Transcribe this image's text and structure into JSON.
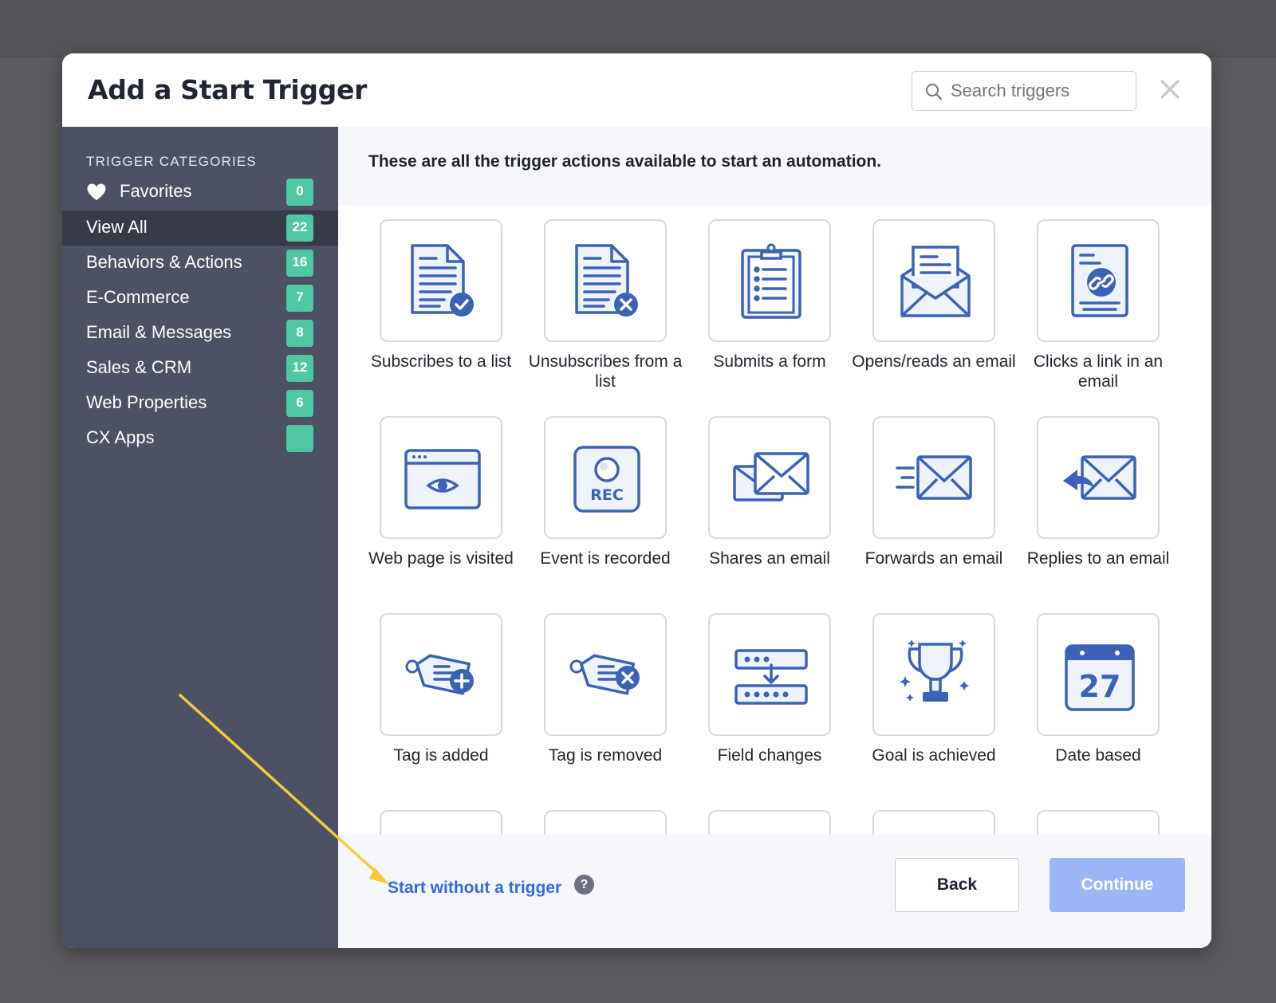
{
  "modal": {
    "title": "Add a Start Trigger",
    "search_placeholder": "Search triggers"
  },
  "sidebar": {
    "heading": "TRIGGER CATEGORIES",
    "categories": [
      {
        "label": "Favorites",
        "count": "0",
        "icon": "heart-icon"
      },
      {
        "label": "View All",
        "count": "22",
        "active": true
      },
      {
        "label": "Behaviors & Actions",
        "count": "16"
      },
      {
        "label": "E-Commerce",
        "count": "7"
      },
      {
        "label": "Email & Messages",
        "count": "8"
      },
      {
        "label": "Sales & CRM",
        "count": "12"
      },
      {
        "label": "Web Properties",
        "count": "6"
      },
      {
        "label": "CX Apps",
        "count": ""
      }
    ]
  },
  "main": {
    "intro": "These are all the trigger actions available to start an automation.",
    "triggers": [
      {
        "label": "Subscribes to a list",
        "icon": "document-check-icon"
      },
      {
        "label": "Unsubscribes from a list",
        "icon": "document-x-icon"
      },
      {
        "label": "Submits a form",
        "icon": "clipboard-form-icon"
      },
      {
        "label": "Opens/reads an email",
        "icon": "open-envelope-icon"
      },
      {
        "label": "Clicks a link in an email",
        "icon": "email-link-icon"
      },
      {
        "label": "Web page is visited",
        "icon": "browser-eye-icon"
      },
      {
        "label": "Event is recorded",
        "icon": "record-icon",
        "icon_text": "REC"
      },
      {
        "label": "Shares an email",
        "icon": "shared-envelopes-icon"
      },
      {
        "label": "Forwards an email",
        "icon": "forward-envelope-icon"
      },
      {
        "label": "Replies to an email",
        "icon": "reply-envelope-icon"
      },
      {
        "label": "Tag is added",
        "icon": "tag-plus-icon"
      },
      {
        "label": "Tag is removed",
        "icon": "tag-x-icon"
      },
      {
        "label": "Field changes",
        "icon": "field-change-icon"
      },
      {
        "label": "Goal is achieved",
        "icon": "trophy-icon"
      },
      {
        "label": "Date based",
        "icon": "calendar-icon",
        "icon_text": "27"
      },
      {
        "label": "",
        "icon": ""
      },
      {
        "label": "",
        "icon": ""
      },
      {
        "label": "",
        "icon": ""
      },
      {
        "label": "",
        "icon": ""
      },
      {
        "label": "",
        "icon": ""
      }
    ]
  },
  "footer": {
    "start_without": "Start without a trigger",
    "help": "?",
    "back": "Back",
    "continue": "Continue"
  },
  "colors": {
    "sidebar_bg": "#4c5165",
    "sidebar_active": "#363a49",
    "badge": "#4fc7a2",
    "icon_blue": "#3a62b6",
    "link_blue": "#356ae6",
    "continue_bg": "#9bb6f5",
    "annotation_arrow": "#f5c93b"
  }
}
